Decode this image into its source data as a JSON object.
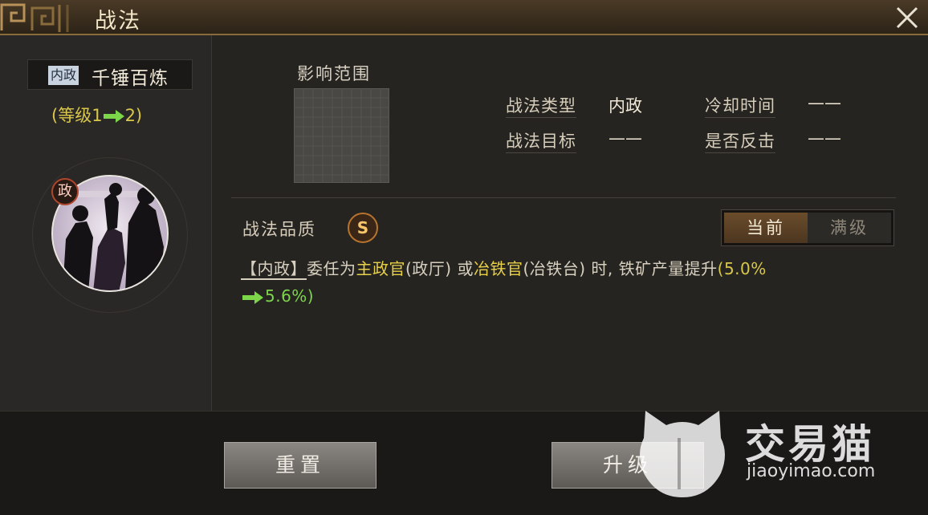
{
  "window": {
    "title": "战法"
  },
  "skill": {
    "category_tag": "内政",
    "name": "千锤百炼",
    "level_prefix": "(等级1",
    "level_suffix": "2)",
    "portrait_badge": "政"
  },
  "range": {
    "label": "影响范围"
  },
  "stats": {
    "type_label": "战法类型",
    "type_value": "内政",
    "target_label": "战法目标",
    "target_value": "——",
    "cooldown_label": "冷却时间",
    "cooldown_value": "——",
    "counter_label": "是否反击",
    "counter_value": "——"
  },
  "quality": {
    "label": "战法品质",
    "grade": "S"
  },
  "tabs": {
    "current": "当前",
    "max": "满级"
  },
  "description": {
    "tag": "【内政】",
    "t1": "委任为",
    "kw1": "主政官",
    "t2": "(政厅) 或",
    "kw2": "冶铁官",
    "t3": "(冶铁台) 时, 铁矿产量提升",
    "from": "(5.0%",
    "to": "5.6%)"
  },
  "buttons": {
    "reset": "重置",
    "upgrade": "升级"
  },
  "watermark": {
    "brand": "交易猫",
    "url": "jiaoyimao.com"
  },
  "colors": {
    "accent_gold": "#d9c74a",
    "arrow_green": "#7dd54a",
    "badge_orange": "#b8742e"
  }
}
